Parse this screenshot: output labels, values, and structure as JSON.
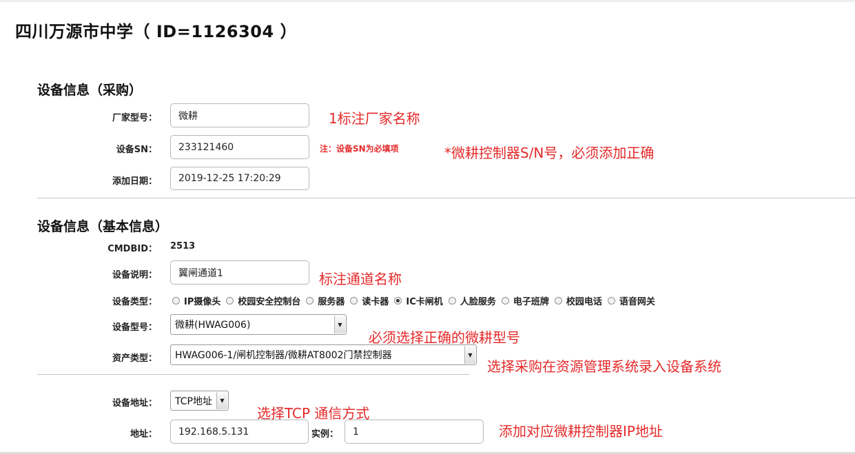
{
  "page": {
    "title": "四川万源市中学（ ID=1126304 ）"
  },
  "purchase": {
    "heading": "设备信息（采购）",
    "vendor_label": "厂家型号：",
    "vendor_value": "微耕",
    "sn_label": "设备SN：",
    "sn_value": "233121460",
    "sn_note": "注：设备SN为必填项",
    "date_label": "添加日期：",
    "date_value": "2019-12-25 17:20:29"
  },
  "basic": {
    "heading": "设备信息（基本信息）",
    "cmdbid_label": "CMDBID：",
    "cmdbid_value": "2513",
    "desc_label": "设备说明：",
    "desc_value": "翼闸通道1",
    "type_label": "设备类型：",
    "types": [
      {
        "label": "IP摄像头",
        "checked": false
      },
      {
        "label": "校园安全控制台",
        "checked": false
      },
      {
        "label": "服务器",
        "checked": false
      },
      {
        "label": "读卡器",
        "checked": false
      },
      {
        "label": "IC卡闸机",
        "checked": true
      },
      {
        "label": "人脸服务",
        "checked": false
      },
      {
        "label": "电子班牌",
        "checked": false
      },
      {
        "label": "校园电话",
        "checked": false
      },
      {
        "label": "语音网关",
        "checked": false
      }
    ],
    "model_label": "设备型号：",
    "model_value": "微耕(HWAG006)",
    "asset_label": "资产类型：",
    "asset_value": "HWAG006-1/闸机控制器/微耕AT8002门禁控制器"
  },
  "address": {
    "type_label": "设备地址：",
    "type_value": "TCP地址",
    "addr_label": "地址：",
    "addr_value": "192.168.5.131",
    "instance_label": "实例：",
    "instance_value": "1"
  },
  "annotations": {
    "vendor": "1标注厂家名称",
    "sn": "*微耕控制器S/N号，必须添加正确",
    "desc": "标注通道名称",
    "model": "必须选择正确的微耕型号",
    "asset": "选择采购在资源管理系统录入设备系统",
    "tcp": "选择TCP 通信方式",
    "ip": "添加对应微耕控制器IP地址"
  },
  "colors": {
    "annotation": "#e52a2a",
    "border": "#b7b7b7"
  }
}
